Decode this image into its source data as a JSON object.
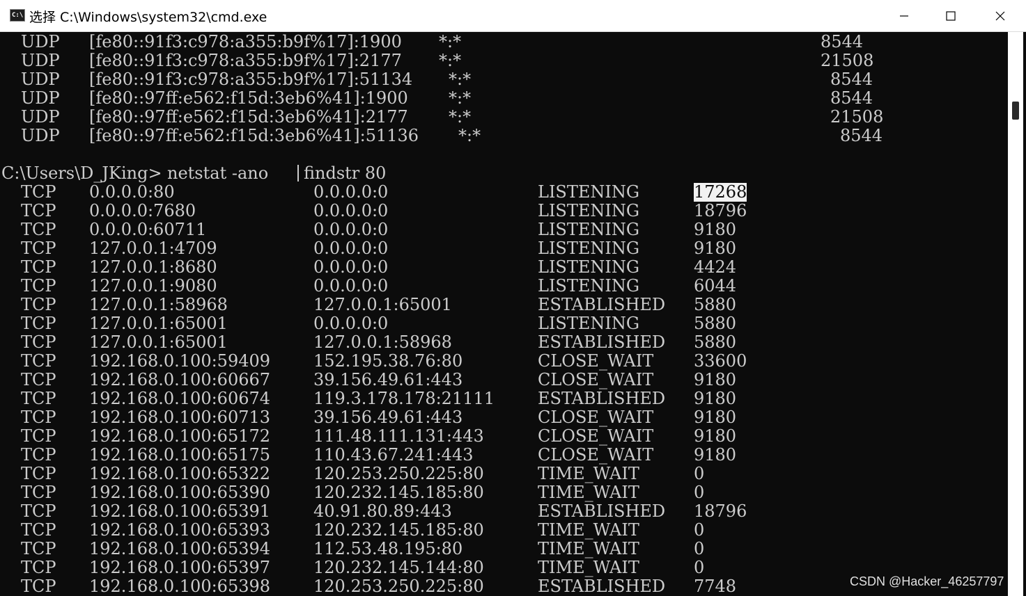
{
  "window": {
    "title": "选择 C:\\Windows\\system32\\cmd.exe",
    "icon": "cmd-console-icon",
    "icon_text": "C:\\",
    "controls": {
      "minimize": "─",
      "maximize": "☐",
      "close": "✕"
    }
  },
  "udp_rows": [
    {
      "proto": "UDP",
      "local": "[fe80::91f3:c978:a355:b9f%17]:1900",
      "foreign": "*:*",
      "pid": "8544"
    },
    {
      "proto": "UDP",
      "local": "[fe80::91f3:c978:a355:b9f%17]:2177",
      "foreign": "*:*",
      "pid": "21508"
    },
    {
      "proto": "UDP",
      "local": "[fe80::91f3:c978:a355:b9f%17]:51134",
      "foreign": "*:*",
      "pid": "8544"
    },
    {
      "proto": "UDP",
      "local": "[fe80::97ff:e562:f15d:3eb6%41]:1900",
      "foreign": "*:*",
      "pid": "8544"
    },
    {
      "proto": "UDP",
      "local": "[fe80::97ff:e562:f15d:3eb6%41]:2177",
      "foreign": "*:*",
      "pid": "21508"
    },
    {
      "proto": "UDP",
      "local": "[fe80::97ff:e562:f15d:3eb6%41]:51136",
      "foreign": "*:*",
      "pid": "8544"
    }
  ],
  "prompt": {
    "path": "C:\\Users\\D_JKing>",
    "command": "netstat -ano ",
    "pipe_part": "findstr 80"
  },
  "tcp_rows": [
    {
      "proto": "TCP",
      "local": "0.0.0.0:80",
      "foreign": "0.0.0.0:0",
      "state": "LISTENING",
      "pid": "17268",
      "selected": true
    },
    {
      "proto": "TCP",
      "local": "0.0.0.0:7680",
      "foreign": "0.0.0.0:0",
      "state": "LISTENING",
      "pid": "18796"
    },
    {
      "proto": "TCP",
      "local": "0.0.0.0:60711",
      "foreign": "0.0.0.0:0",
      "state": "LISTENING",
      "pid": "9180"
    },
    {
      "proto": "TCP",
      "local": "127.0.0.1:4709",
      "foreign": "0.0.0.0:0",
      "state": "LISTENING",
      "pid": "9180"
    },
    {
      "proto": "TCP",
      "local": "127.0.0.1:8680",
      "foreign": "0.0.0.0:0",
      "state": "LISTENING",
      "pid": "4424"
    },
    {
      "proto": "TCP",
      "local": "127.0.0.1:9080",
      "foreign": "0.0.0.0:0",
      "state": "LISTENING",
      "pid": "6044"
    },
    {
      "proto": "TCP",
      "local": "127.0.0.1:58968",
      "foreign": "127.0.0.1:65001",
      "state": "ESTABLISHED",
      "pid": "5880"
    },
    {
      "proto": "TCP",
      "local": "127.0.0.1:65001",
      "foreign": "0.0.0.0:0",
      "state": "LISTENING",
      "pid": "5880"
    },
    {
      "proto": "TCP",
      "local": "127.0.0.1:65001",
      "foreign": "127.0.0.1:58968",
      "state": "ESTABLISHED",
      "pid": "5880"
    },
    {
      "proto": "TCP",
      "local": "192.168.0.100:59409",
      "foreign": "152.195.38.76:80",
      "state": "CLOSE_WAIT",
      "pid": "33600"
    },
    {
      "proto": "TCP",
      "local": "192.168.0.100:60667",
      "foreign": "39.156.49.61:443",
      "state": "CLOSE_WAIT",
      "pid": "9180"
    },
    {
      "proto": "TCP",
      "local": "192.168.0.100:60674",
      "foreign": "119.3.178.178:21111",
      "state": "ESTABLISHED",
      "pid": "9180"
    },
    {
      "proto": "TCP",
      "local": "192.168.0.100:60713",
      "foreign": "39.156.49.61:443",
      "state": "CLOSE_WAIT",
      "pid": "9180"
    },
    {
      "proto": "TCP",
      "local": "192.168.0.100:65172",
      "foreign": "111.48.111.131:443",
      "state": "CLOSE_WAIT",
      "pid": "9180"
    },
    {
      "proto": "TCP",
      "local": "192.168.0.100:65175",
      "foreign": "110.43.67.241:443",
      "state": "CLOSE_WAIT",
      "pid": "9180"
    },
    {
      "proto": "TCP",
      "local": "192.168.0.100:65322",
      "foreign": "120.253.250.225:80",
      "state": "TIME_WAIT",
      "pid": "0"
    },
    {
      "proto": "TCP",
      "local": "192.168.0.100:65390",
      "foreign": "120.232.145.185:80",
      "state": "TIME_WAIT",
      "pid": "0"
    },
    {
      "proto": "TCP",
      "local": "192.168.0.100:65391",
      "foreign": "40.91.80.89:443",
      "state": "ESTABLISHED",
      "pid": "18796"
    },
    {
      "proto": "TCP",
      "local": "192.168.0.100:65393",
      "foreign": "120.232.145.185:80",
      "state": "TIME_WAIT",
      "pid": "0"
    },
    {
      "proto": "TCP",
      "local": "192.168.0.100:65394",
      "foreign": "112.53.48.195:80",
      "state": "TIME_WAIT",
      "pid": "0"
    },
    {
      "proto": "TCP",
      "local": "192.168.0.100:65397",
      "foreign": "120.232.145.144:80",
      "state": "TIME_WAIT",
      "pid": "0"
    },
    {
      "proto": "TCP",
      "local": "192.168.0.100:65398",
      "foreign": "120.253.250.225:80",
      "state": "ESTABLISHED",
      "pid": "7748"
    }
  ],
  "watermark": "CSDN @Hacker_46257797",
  "colors": {
    "console_bg": "#0c0c0c",
    "console_text": "#cccccc",
    "selection_bg": "#f2f2f2"
  }
}
